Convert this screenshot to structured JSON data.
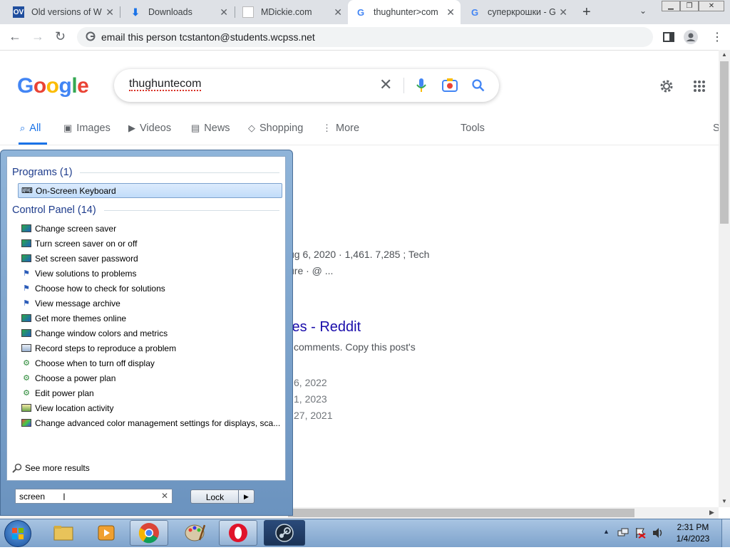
{
  "browser": {
    "tabs": [
      {
        "label": "Old versions of W",
        "icon": "oldversion-favicon",
        "icon_text": "OV"
      },
      {
        "label": "Downloads",
        "icon": "download-icon"
      },
      {
        "label": "MDickie.com",
        "icon": "blank-page-icon"
      },
      {
        "label": "thughunter>com",
        "icon": "google-favicon",
        "active": true
      },
      {
        "label": "суперкрошки - G",
        "icon": "google-favicon"
      }
    ],
    "address": "email this person tcstanton@students.wcpss.net"
  },
  "google": {
    "logo": "Google",
    "query": "thughuntecom",
    "nav": {
      "all": "All",
      "images": "Images",
      "videos": "Videos",
      "news": "News",
      "shopping": "Shopping",
      "more": "More",
      "tools": "Tools",
      "cut": "S"
    },
    "results": {
      "r1_line1": "ug 6, 2020 · 1,461. 7,285 ; Tech",
      "r1_line2": "ure · @ ...",
      "r2_title": "ies - Reddit",
      "r2_line1": "comments. Copy this post's",
      "r2_d1": "6, 2022",
      "r2_d2": "1, 2023",
      "r2_d3": "27, 2021"
    }
  },
  "startmenu": {
    "programs_header": "Programs (1)",
    "programs": [
      {
        "label": "On-Screen Keyboard",
        "icon": "keyboard-icon"
      }
    ],
    "control_header": "Control Panel (14)",
    "control_items": [
      {
        "label": "Change screen saver",
        "icon": "display-icon"
      },
      {
        "label": "Turn screen saver on or off",
        "icon": "display-icon"
      },
      {
        "label": "Set screen saver password",
        "icon": "display-icon"
      },
      {
        "label": "View solutions to problems",
        "icon": "flag-icon"
      },
      {
        "label": "Choose how to check for solutions",
        "icon": "flag-icon"
      },
      {
        "label": "View message archive",
        "icon": "flag-icon"
      },
      {
        "label": "Get more themes online",
        "icon": "display-icon"
      },
      {
        "label": "Change window colors and metrics",
        "icon": "display-icon"
      },
      {
        "label": "Record steps to reproduce a problem",
        "icon": "steps-recorder-icon"
      },
      {
        "label": "Choose when to turn off display",
        "icon": "power-icon"
      },
      {
        "label": "Choose a power plan",
        "icon": "power-icon"
      },
      {
        "label": "Edit power plan",
        "icon": "power-icon"
      },
      {
        "label": "View location activity",
        "icon": "location-icon"
      },
      {
        "label": "Change advanced color management settings for displays, sca...",
        "icon": "color-management-icon"
      }
    ],
    "see_more": "See more results",
    "search_value": "screen",
    "lock_label": "Lock"
  },
  "taskbar": {
    "time": "2:31 PM",
    "date": "1/4/2023"
  }
}
